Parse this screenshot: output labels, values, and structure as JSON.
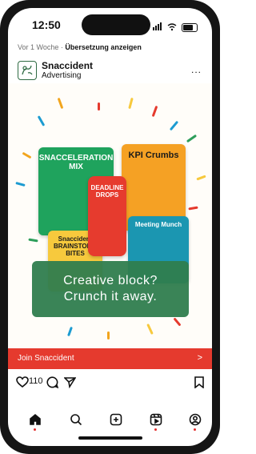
{
  "status_bar": {
    "time": "12:50"
  },
  "post": {
    "meta_prefix": "Vor 1 Woche · ",
    "meta_translate": "Übersetzung anzeigen",
    "brand_name": "Snaccident",
    "brand_subtitle": "Advertising",
    "more_label": "..."
  },
  "ad": {
    "products": [
      {
        "label": "SNACCELERATION MIX"
      },
      {
        "label": "KPI Crumbs"
      },
      {
        "label": "DEADLINE DROPS"
      },
      {
        "label": "Snaccident BRAINSTORM BITES"
      },
      {
        "label": "Meeting Munch"
      }
    ],
    "callout_text": "Creative block?\nCrunch it away."
  },
  "cta": {
    "label": "Join Snaccident",
    "arrow": ">"
  },
  "actions": {
    "like_count": "110"
  },
  "colors": {
    "brand_green": "#2f7d4e",
    "cta_red": "#e53a2e",
    "nav_dot_red": "#e32b2b"
  },
  "icons": {
    "heart": "heart-icon",
    "comment": "comment-icon",
    "share": "share-icon",
    "bookmark": "bookmark-icon",
    "home": "home-icon",
    "search": "search-icon",
    "add": "add-icon",
    "reels": "reels-icon",
    "profile": "profile-icon"
  }
}
